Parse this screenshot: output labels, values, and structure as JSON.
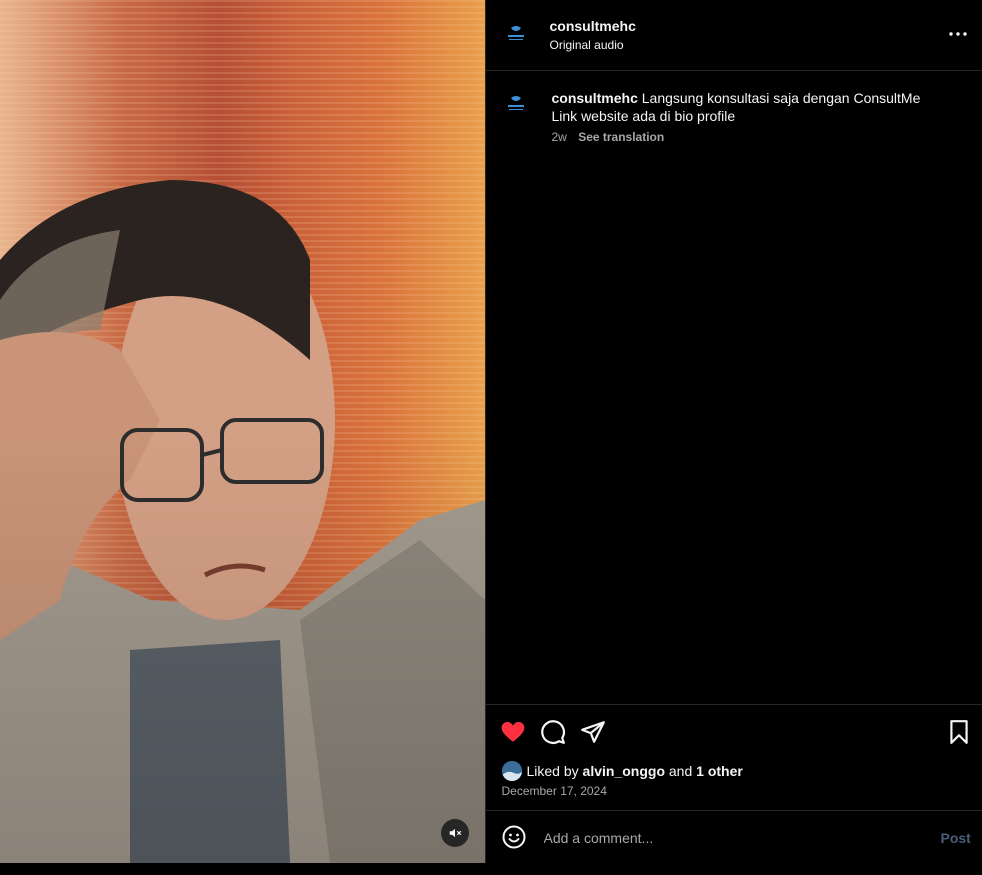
{
  "post": {
    "username": "consultmehc",
    "audio_label": "Original audio",
    "caption": {
      "username": "consultmehc",
      "line1": "Langsung konsultasi saja dengan ConsultMe",
      "line2": "Link website ada di bio profile",
      "age": "2w",
      "translate_label": "See translation"
    },
    "likes": {
      "prefix": "Liked by",
      "first_liker": "alvin_onggo",
      "conjunction": "and",
      "others": "1 other"
    },
    "date": "December 17, 2024"
  },
  "comment": {
    "placeholder": "Add a comment...",
    "post_label": "Post"
  },
  "icons": {
    "like": "heart-filled-icon",
    "comment": "comment-icon",
    "share": "send-icon",
    "save": "bookmark-icon",
    "more": "more-icon",
    "mute": "muted-speaker-icon",
    "emoji": "emoji-icon"
  },
  "colors": {
    "like": "#ff3040",
    "post_button": "#4a5d7a",
    "secondary_text": "#a8a8a8",
    "divider": "#262626"
  }
}
